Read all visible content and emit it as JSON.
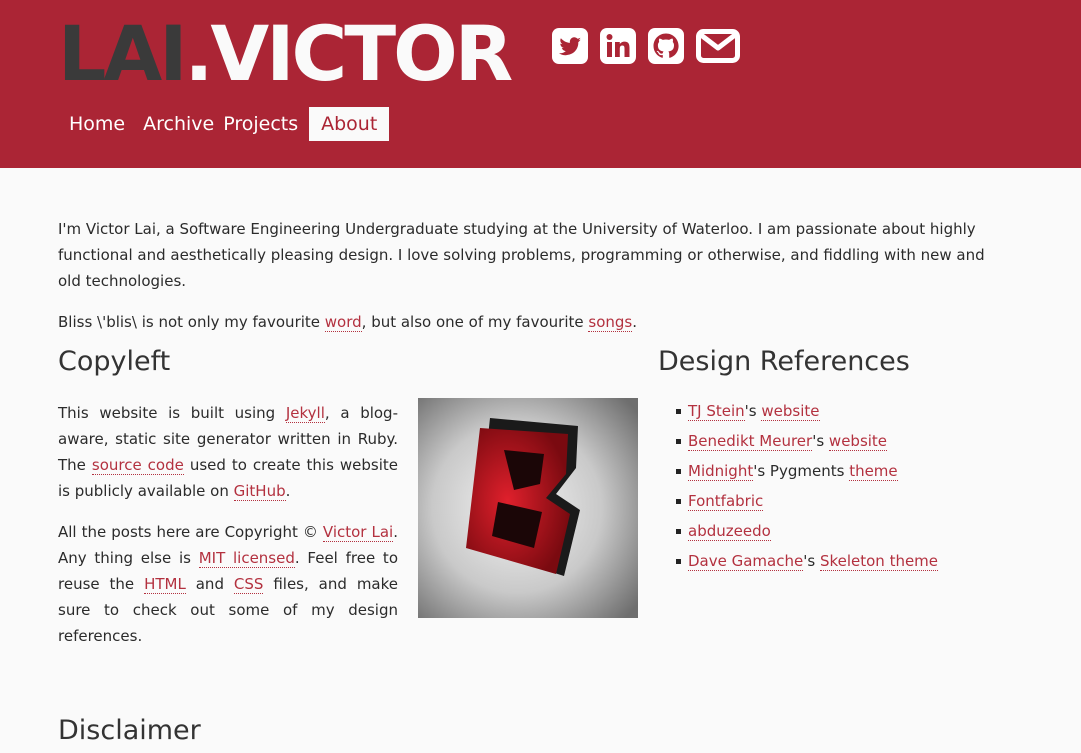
{
  "brand": {
    "first": "LAI",
    "dot": ".",
    "second": "VICTOR"
  },
  "social": [
    "twitter-icon",
    "linkedin-icon",
    "github-icon",
    "email-icon"
  ],
  "nav": {
    "home": "Home",
    "archive": "Archive",
    "projects": "Projects",
    "about": "About"
  },
  "intro": {
    "p1": "I'm Victor Lai, a Software Engineering Undergraduate studying at the University of Waterloo. I am passionate about highly functional and aesthetically pleasing design. I love solving problems, programming or otherwise, and fiddling with new and old technologies.",
    "bliss_pre": "Bliss \\'blis\\ is not only my favourite ",
    "word": "word",
    "bliss_mid": ", but also one of my favourite ",
    "songs": "songs",
    "bliss_end": "."
  },
  "copyleft": {
    "heading": "Copyleft",
    "p1_a": "This website is built using ",
    "jekyll": "Jekyll",
    "p1_b": ", a blog-aware, static site generator written in Ruby. The ",
    "source_code": "source code",
    "p1_c": " used to create this website is publicly available on ",
    "github": "GitHub",
    "p1_d": ".",
    "p2_a": "All the posts here are Copyright © ",
    "victor_lai": "Victor Lai",
    "p2_b": ". Any thing else is ",
    "mit": "MIT licensed",
    "p2_c": ". Feel free to reuse the ",
    "html": "HTML",
    "p2_d": " and ",
    "css": "CSS",
    "p2_e": " files, and make sure to check out some of my design references."
  },
  "design": {
    "heading": "Design References",
    "refs": [
      {
        "link": "TJ Stein",
        "sep": "'s ",
        "link2": "website"
      },
      {
        "link": "Benedikt Meurer",
        "sep": "'s ",
        "link2": "website"
      },
      {
        "link": "Midnight",
        "sep": "'s Pygments ",
        "link2": "theme"
      },
      {
        "link": "Fontfabric"
      },
      {
        "link": "abduzeedo"
      },
      {
        "link": "Dave Gamache",
        "sep": "'s ",
        "link2": "Skeleton theme"
      }
    ]
  },
  "disclaimer": {
    "heading": "Disclaimer"
  },
  "colors": {
    "header": "#ab2535",
    "link": "#b3313f",
    "background": "#fafafa"
  }
}
